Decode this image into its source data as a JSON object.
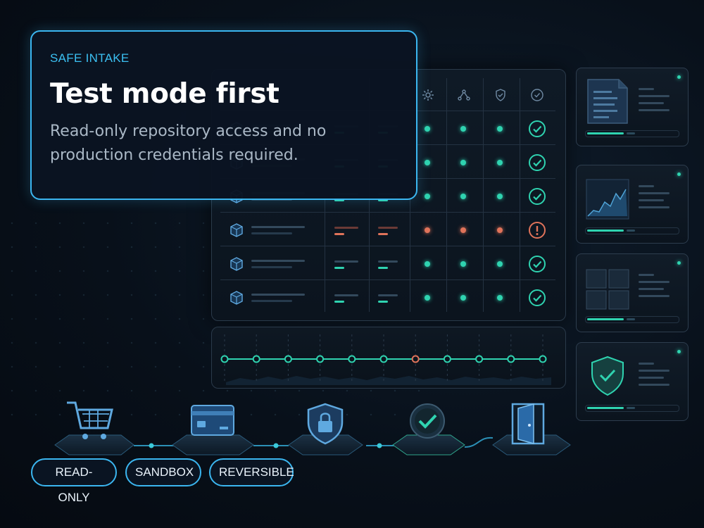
{
  "hero": {
    "eyebrow": "SAFE INTAKE",
    "title": "Test mode first",
    "description": "Read-only repository access and no production credentials required."
  },
  "chips": [
    "READ-ONLY",
    "SANDBOX",
    "REVERSIBLE"
  ],
  "table": {
    "header_icons": [
      "gear-icon",
      "network-icon",
      "shield-icon",
      "check-circle-icon"
    ],
    "rows": [
      {
        "status": "ok"
      },
      {
        "status": "ok"
      },
      {
        "status": "ok"
      },
      {
        "status": "warning"
      },
      {
        "status": "ok"
      },
      {
        "status": "ok"
      }
    ]
  },
  "timeline": {
    "nodes": 11,
    "alert_index": 6
  },
  "side_cards": [
    {
      "icon": "document-icon",
      "progress": 0.62
    },
    {
      "icon": "area-chart-icon",
      "progress": 0.62
    },
    {
      "icon": "grid-icon",
      "progress": 0.62
    },
    {
      "icon": "shield-check-icon",
      "progress": 0.62
    }
  ],
  "pipeline": [
    "cart-icon",
    "credit-card-icon",
    "padlock-shield-icon",
    "check-circle-icon",
    "exit-door-icon"
  ],
  "colors": {
    "accent": "#3bb6f0",
    "ok": "#2fd3b0",
    "warn": "#e0735a"
  }
}
